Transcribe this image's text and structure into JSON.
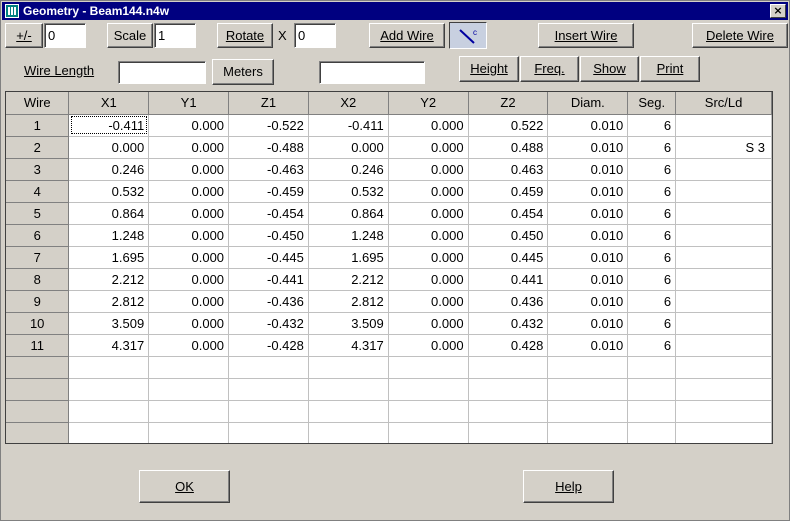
{
  "window": {
    "title": "Geometry - Beam144.n4w",
    "close_glyph": "×"
  },
  "toolbar": {
    "plusminus_label": "+/-",
    "plusminus_value": "0",
    "scale_label": "Scale",
    "scale_value": "1",
    "rotate_label": "Rotate",
    "rotate_axis": "X",
    "rotate_value": "0",
    "add_wire_label": "Add Wire",
    "insert_wire_label": "Insert Wire",
    "delete_wire_label": "Delete Wire"
  },
  "row2": {
    "wire_length_label": "Wire Length",
    "wire_length_value": "",
    "units_label": "Meters",
    "result_value": "",
    "height_label": "Height",
    "freq_label": "Freq.",
    "show_label": "Show",
    "print_label": "Print"
  },
  "grid": {
    "columns": [
      "Wire",
      "X1",
      "Y1",
      "Z1",
      "X2",
      "Y2",
      "Z2",
      "Diam.",
      "Seg.",
      "Src/Ld"
    ],
    "rows": [
      [
        "1",
        "-0.411",
        "0.000",
        "-0.522",
        "-0.411",
        "0.000",
        "0.522",
        "0.010",
        "6",
        ""
      ],
      [
        "2",
        "0.000",
        "0.000",
        "-0.488",
        "0.000",
        "0.000",
        "0.488",
        "0.010",
        "6",
        "S 3"
      ],
      [
        "3",
        "0.246",
        "0.000",
        "-0.463",
        "0.246",
        "0.000",
        "0.463",
        "0.010",
        "6",
        ""
      ],
      [
        "4",
        "0.532",
        "0.000",
        "-0.459",
        "0.532",
        "0.000",
        "0.459",
        "0.010",
        "6",
        ""
      ],
      [
        "5",
        "0.864",
        "0.000",
        "-0.454",
        "0.864",
        "0.000",
        "0.454",
        "0.010",
        "6",
        ""
      ],
      [
        "6",
        "1.248",
        "0.000",
        "-0.450",
        "1.248",
        "0.000",
        "0.450",
        "0.010",
        "6",
        ""
      ],
      [
        "7",
        "1.695",
        "0.000",
        "-0.445",
        "1.695",
        "0.000",
        "0.445",
        "0.010",
        "6",
        ""
      ],
      [
        "8",
        "2.212",
        "0.000",
        "-0.441",
        "2.212",
        "0.000",
        "0.441",
        "0.010",
        "6",
        ""
      ],
      [
        "9",
        "2.812",
        "0.000",
        "-0.436",
        "2.812",
        "0.000",
        "0.436",
        "0.010",
        "6",
        ""
      ],
      [
        "10",
        "3.509",
        "0.000",
        "-0.432",
        "3.509",
        "0.000",
        "0.432",
        "0.010",
        "6",
        ""
      ],
      [
        "11",
        "4.317",
        "0.000",
        "-0.428",
        "4.317",
        "0.000",
        "0.428",
        "0.010",
        "6",
        ""
      ],
      [
        "",
        "",
        "",
        "",
        "",
        "",
        "",
        "",
        "",
        ""
      ],
      [
        "",
        "",
        "",
        "",
        "",
        "",
        "",
        "",
        "",
        ""
      ],
      [
        "",
        "",
        "",
        "",
        "",
        "",
        "",
        "",
        "",
        ""
      ],
      [
        "",
        "",
        "",
        "",
        "",
        "",
        "",
        "",
        "",
        ""
      ]
    ]
  },
  "footer": {
    "ok_label": "OK",
    "help_label": "Help"
  }
}
